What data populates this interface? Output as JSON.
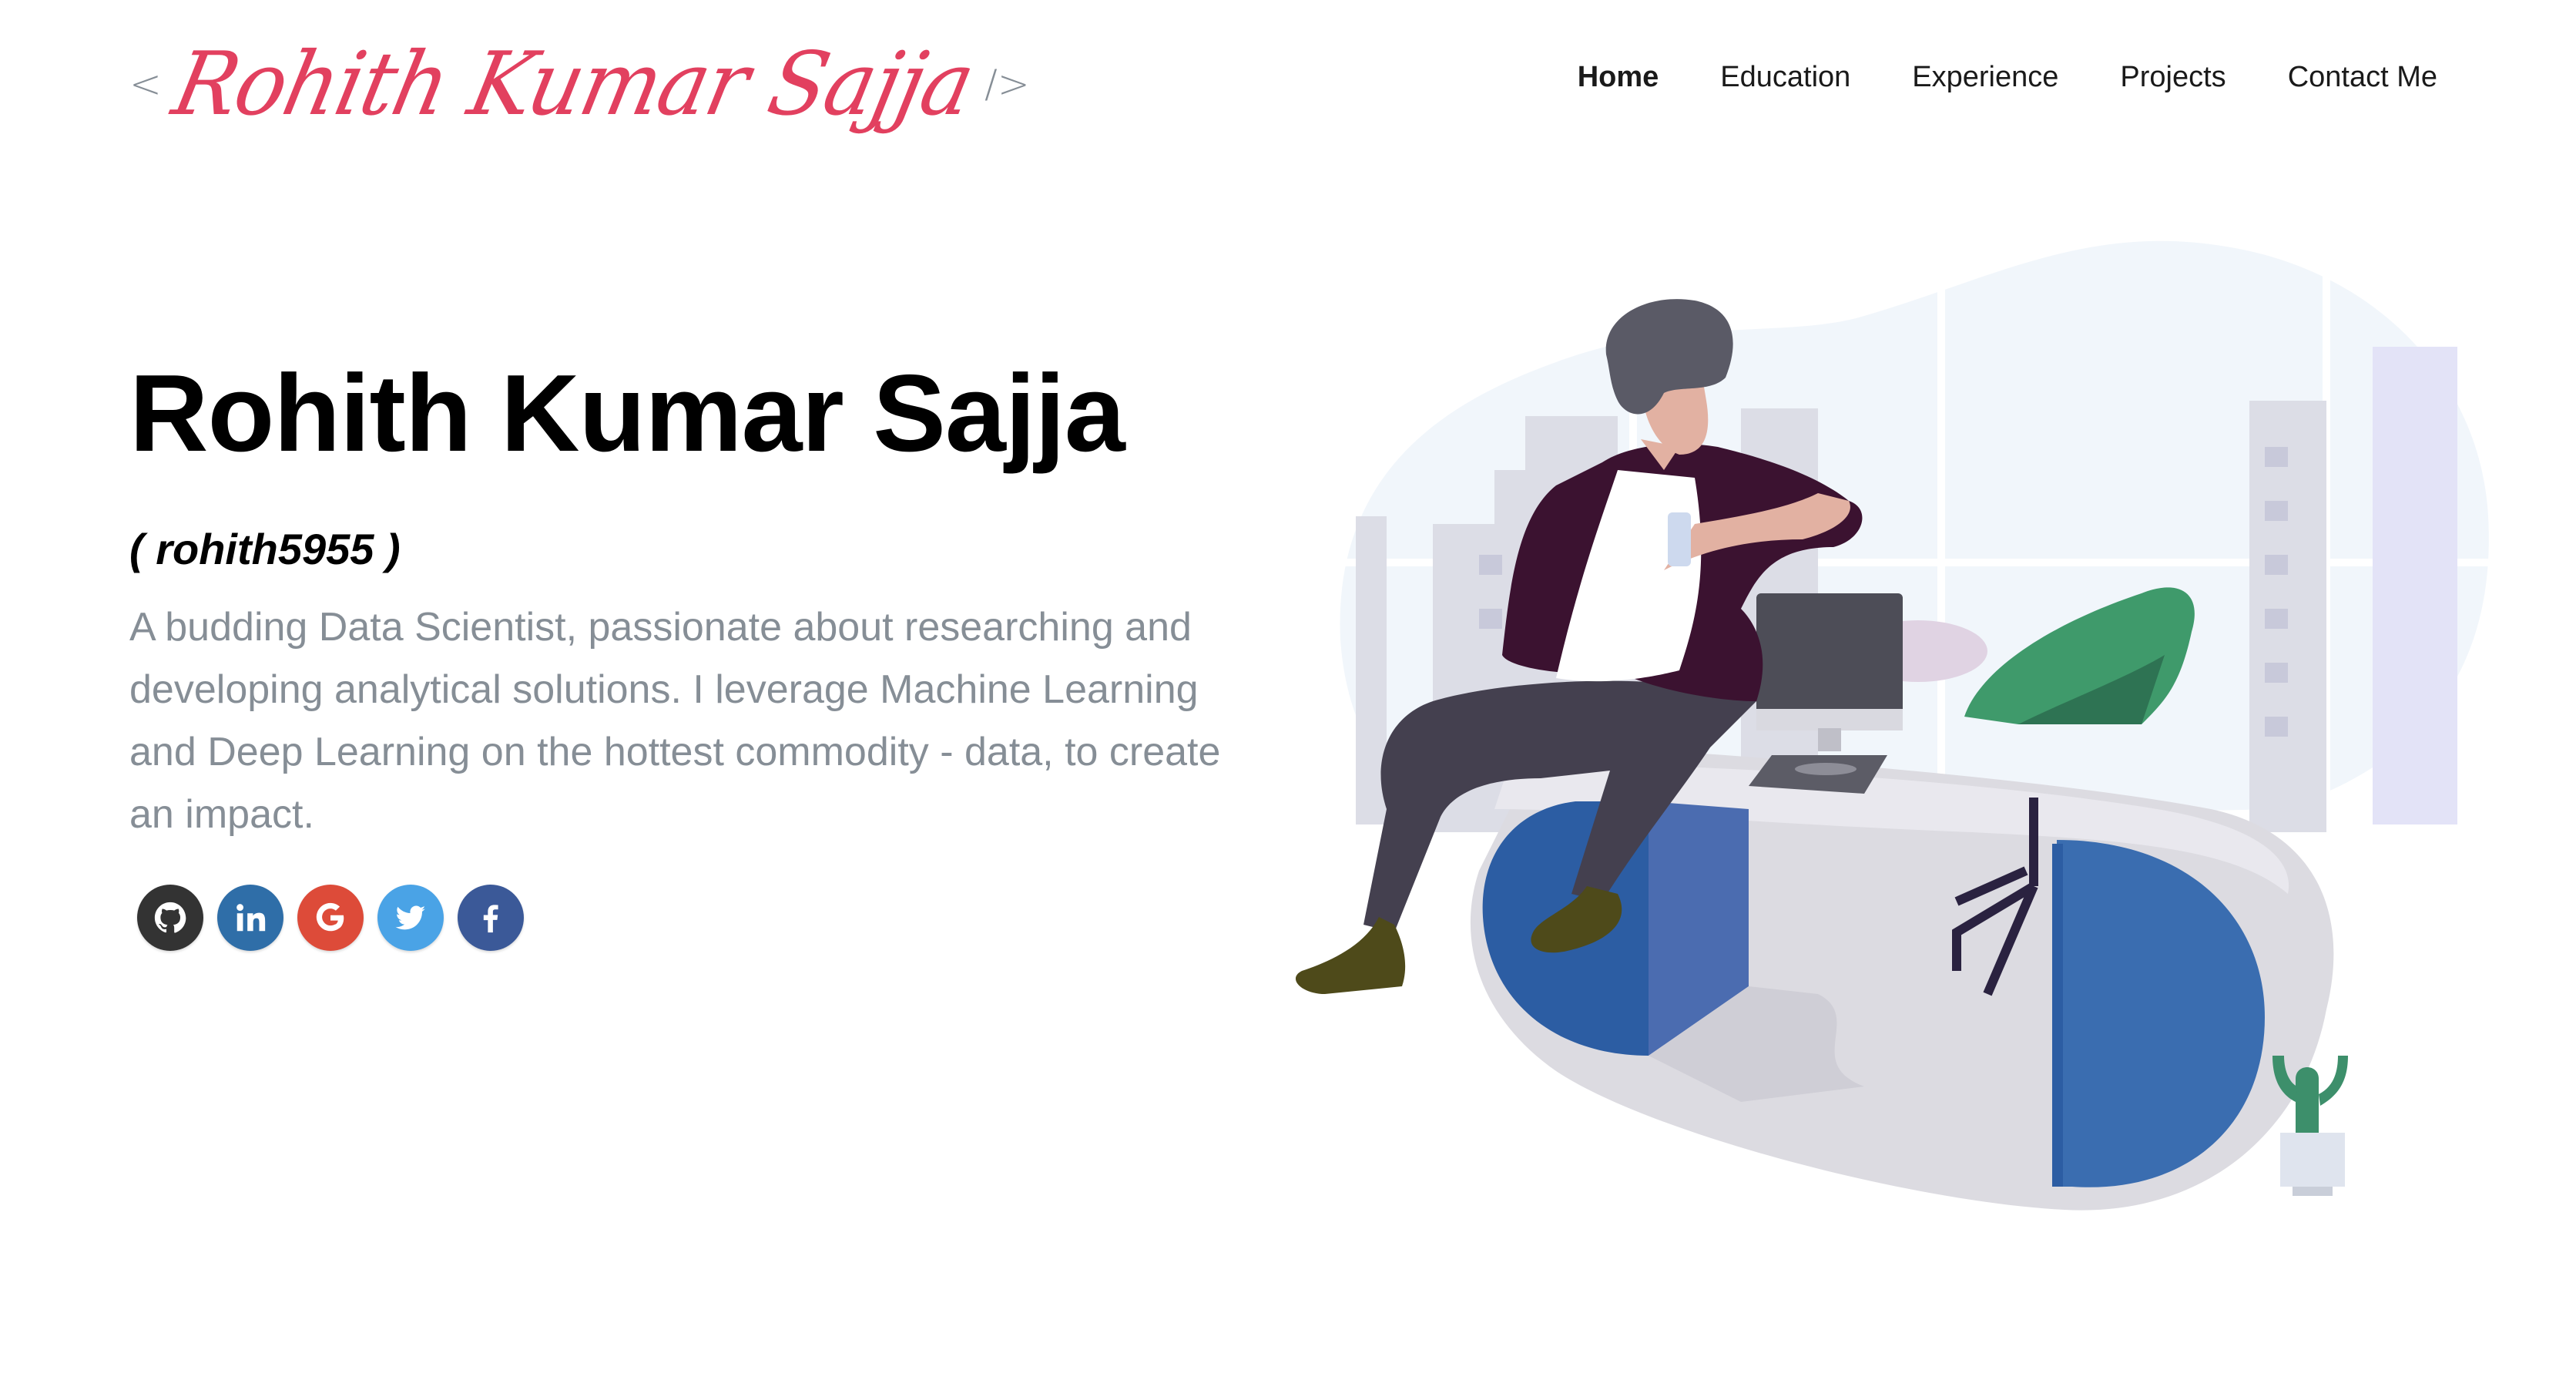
{
  "header": {
    "logo": {
      "open_bracket": "<",
      "signature": "Rohith Kumar Sajja",
      "close_bracket": "/>"
    },
    "nav": [
      {
        "label": "Home",
        "active": true
      },
      {
        "label": "Education",
        "active": false
      },
      {
        "label": "Experience",
        "active": false
      },
      {
        "label": "Projects",
        "active": false
      },
      {
        "label": "Contact Me",
        "active": false
      }
    ]
  },
  "hero": {
    "title": "Rohith Kumar Sajja",
    "handle": "( rohith5955 )",
    "bio": "A budding Data Scientist, passionate about researching and developing analytical solutions. I leverage Machine Learning and Deep Learning on the hottest commodity - data, to create an impact."
  },
  "social": [
    {
      "icon": "github-icon",
      "color": "#333333"
    },
    {
      "icon": "linkedin-icon",
      "color": "#2f6ea8"
    },
    {
      "icon": "google-icon",
      "color": "#dd4b39"
    },
    {
      "icon": "twitter-icon",
      "color": "#4aa3e6"
    },
    {
      "icon": "facebook-icon",
      "color": "#3b5998"
    }
  ],
  "colors": {
    "accent": "#e2405f",
    "subtitle_gray": "#868e96",
    "desk_blue": "#3a6db0",
    "chair_green": "#3f9a6b"
  },
  "illustration": "person-sitting-on-desk-illustration"
}
